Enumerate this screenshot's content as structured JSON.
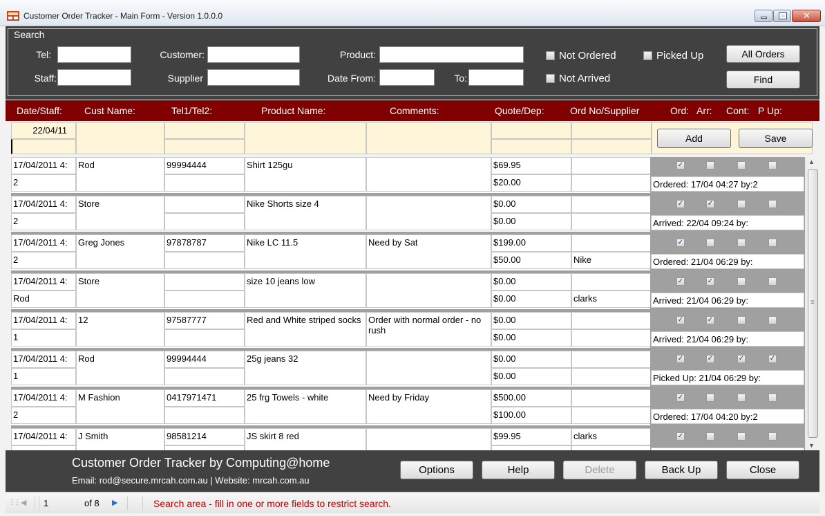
{
  "window": {
    "title": "Customer Order Tracker - Main Form - Version 1.0.0.0",
    "close_glyph": "✕"
  },
  "search": {
    "legend": "Search",
    "tel_label": "Tel:",
    "staff_label": "Staff:",
    "customer_label": "Customer:",
    "supplier_label": "Supplier",
    "product_label": "Product:",
    "date_from_label": "Date From:",
    "to_label": "To:",
    "not_ordered_label": "Not Ordered",
    "not_arrived_label": "Not Arrived",
    "picked_up_label": "Picked Up",
    "all_orders_button": "All Orders",
    "find_button": "Find"
  },
  "columns": {
    "date_staff": "Date/Staff:",
    "cust_name": "Cust Name:",
    "tel": "Tel1/Tel2:",
    "product": "Product Name:",
    "comments": "Comments:",
    "quote_dep": "Quote/Dep:",
    "ord_supplier": "Ord No/Supplier",
    "ord": "Ord:",
    "arr": "Arr:",
    "cont": "Cont:",
    "pup": "P Up:"
  },
  "entry": {
    "date": "22/04/11",
    "add_button": "Add",
    "save_button": "Save"
  },
  "check_glyph": "✓",
  "orders": [
    {
      "date": "17/04/2011 4:",
      "staff": "2",
      "customer": "Rod",
      "tel1": "99994444",
      "tel2": "",
      "product": "Shirt 125gu",
      "comments": "",
      "quote": "$69.95",
      "deposit": "$20.00",
      "ord_no": "",
      "supplier": "",
      "ordered": true,
      "arrived": false,
      "contacted": false,
      "picked_up": false,
      "status": "Ordered: 17/04 04:27 by:2"
    },
    {
      "date": "17/04/2011 4:",
      "staff": "2",
      "customer": "Store",
      "tel1": "",
      "tel2": "",
      "product": "Nike Shorts size 4",
      "comments": "",
      "quote": "$0.00",
      "deposit": "$0.00",
      "ord_no": "",
      "supplier": "",
      "ordered": true,
      "arrived": true,
      "contacted": false,
      "picked_up": false,
      "status": "Arrived: 22/04 09:24 by:"
    },
    {
      "date": "17/04/2011 4:",
      "staff": "2",
      "customer": "Greg Jones",
      "tel1": "97878787",
      "tel2": "",
      "product": "Nike LC 11.5",
      "comments": "Need by Sat",
      "quote": "$199.00",
      "deposit": "$50.00",
      "ord_no": "",
      "supplier": "Nike",
      "ordered": true,
      "arrived": false,
      "contacted": false,
      "picked_up": false,
      "status": "Ordered: 21/04 06:29 by:"
    },
    {
      "date": "17/04/2011 4:",
      "staff": "Rod",
      "customer": "Store",
      "tel1": "",
      "tel2": "",
      "product": "size 10 jeans low",
      "comments": "",
      "quote": "$0.00",
      "deposit": "$0.00",
      "ord_no": "",
      "supplier": "clarks",
      "ordered": true,
      "arrived": true,
      "contacted": false,
      "picked_up": false,
      "status": "Arrived: 21/04 06:29 by:"
    },
    {
      "date": "17/04/2011 4:",
      "staff": "1",
      "customer": "12",
      "tel1": "97587777",
      "tel2": "",
      "product": "Red and White striped socks",
      "comments": "Order with normal order - no rush",
      "quote": "$0.00",
      "deposit": "$0.00",
      "ord_no": "",
      "supplier": "",
      "ordered": true,
      "arrived": true,
      "contacted": false,
      "picked_up": false,
      "status": "Arrived: 21/04 06:29 by:"
    },
    {
      "date": "17/04/2011 4:",
      "staff": "1",
      "customer": "Rod",
      "tel1": "99994444",
      "tel2": "",
      "product": "25g jeans 32",
      "comments": "",
      "quote": "$0.00",
      "deposit": "$0.00",
      "ord_no": "",
      "supplier": "",
      "ordered": true,
      "arrived": true,
      "contacted": true,
      "picked_up": true,
      "status": "Picked Up: 21/04 06:29 by:"
    },
    {
      "date": "17/04/2011 4:",
      "staff": "2",
      "customer": "M Fashion",
      "tel1": "0417971471",
      "tel2": "",
      "product": "25 frg Towels - white",
      "comments": "Need by Friday",
      "quote": "$500.00",
      "deposit": "$100.00",
      "ord_no": "",
      "supplier": "",
      "ordered": true,
      "arrived": false,
      "contacted": false,
      "picked_up": false,
      "status": "Ordered: 17/04 04:20 by:2"
    },
    {
      "date": "17/04/2011 4:",
      "staff": "",
      "customer": "J Smith",
      "tel1": "98581214",
      "tel2": "",
      "product": "JS skirt 8 red",
      "comments": "",
      "quote": "$99.95",
      "deposit": "",
      "ord_no": "clarks",
      "supplier": "",
      "ordered": true,
      "arrived": false,
      "contacted": false,
      "picked_up": false,
      "status": ""
    }
  ],
  "footer": {
    "title": "Customer Order Tracker by Computing@home",
    "contact": "Email: rod@secure.mrcah.com.au  |  Website: mrcah.com.au",
    "options_button": "Options",
    "help_button": "Help",
    "delete_button": "Delete",
    "backup_button": "Back Up",
    "close_button": "Close"
  },
  "statusbar": {
    "page": "1",
    "page_of": "of 8",
    "message": "Search area - fill in one or more fields to restrict search."
  }
}
